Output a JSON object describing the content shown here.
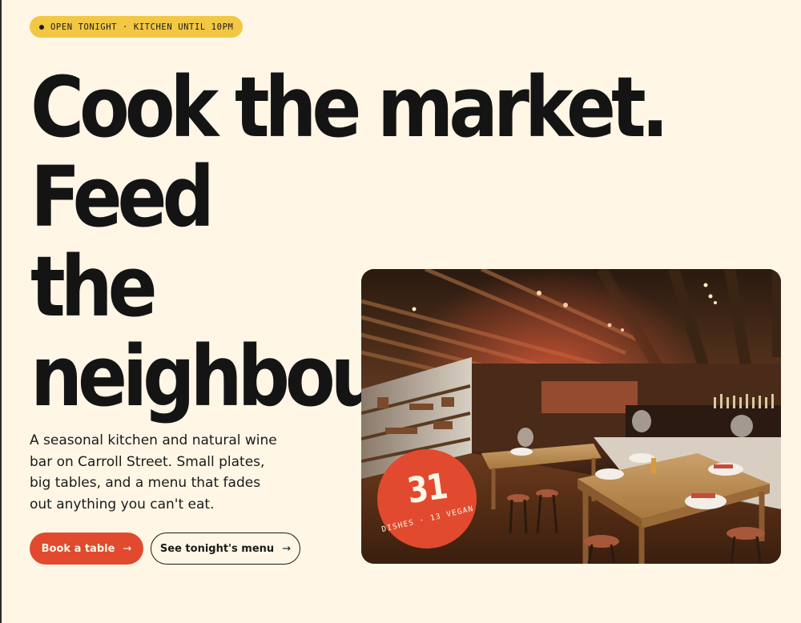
{
  "badge": {
    "text": "OPEN TONIGHT · KITCHEN UNTIL 10PM"
  },
  "headline": {
    "line1": "Cook the market. Feed",
    "line2": "the neighbourhood."
  },
  "intro": {
    "text": "A seasonal kitchen and natural wine bar on Carroll Street. Small plates, big tables, and a menu that fades out anything you can't eat."
  },
  "actions": {
    "primary_label": "Book a table",
    "secondary_label": "See tonight's menu",
    "arrow": "→"
  },
  "hero": {
    "alt": "Restaurant dining room with wooden tables and bar"
  },
  "sticker": {
    "number": "31",
    "caption": "DISHES · 13 VEGAN"
  },
  "colors": {
    "background": "#fff6e6",
    "accent": "#e14a2e",
    "badge": "#f2c744",
    "ink": "#141414"
  },
  "icons": {
    "status": "status-dot-icon",
    "arrow": "arrow-right-icon"
  }
}
